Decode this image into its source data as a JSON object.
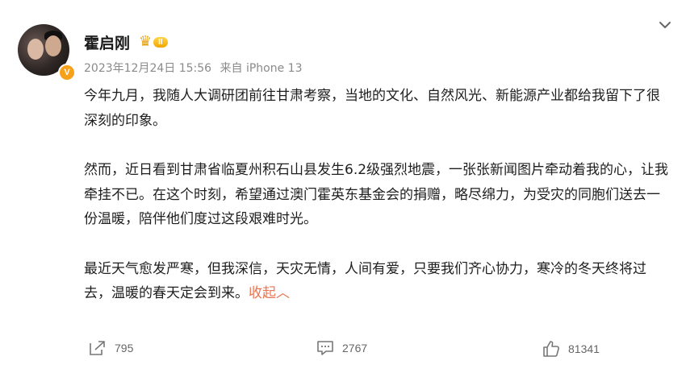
{
  "post": {
    "username": "霍启刚",
    "level_badge": "II",
    "verified_badge": "V",
    "timestamp": "2023年12月24日 15:56",
    "source": "来自 iPhone 13",
    "paragraph1": "今年九月，我随人大调研团前往甘肃考察，当地的文化、自然风光、新能源产业都给我留下了很深刻的印象。",
    "paragraph2": "然而，近日看到甘肃省临夏州积石山县发生6.2级强烈地震，一张张新闻图片牵动着我的心，让我牵挂不已。在这个时刻，希望通过澳门霍英东基金会的捐赠，略尽绵力，为受灾的同胞们送去一份温暖，陪伴他们度过这段艰难时光。",
    "paragraph3": "最近天气愈发严寒，但我深信，天灾无情，人间有爱，只要我们齐心协力，寒冷的冬天终将过去，温暖的春天定会到来。",
    "collapse_label": "收起",
    "collapse_arrow": "︿"
  },
  "actions": {
    "share_count": "795",
    "comment_count": "2767",
    "like_count": "81341"
  },
  "icons": {
    "menu": "chevron-down-icon",
    "share": "share-icon",
    "comment": "comment-icon",
    "like": "thumbs-up-icon"
  },
  "colors": {
    "accent": "#eb7350",
    "meta": "#8a8a8a",
    "vip": "#f7a11a"
  }
}
